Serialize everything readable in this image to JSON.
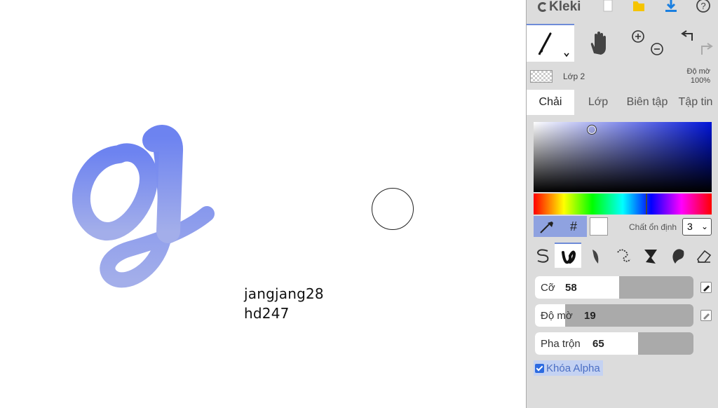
{
  "canvas": {
    "text_line_1": "jangjang28",
    "text_line_2": "hd247",
    "stroke_gradient": [
      "#6d83f0",
      "#9ea8ea"
    ]
  },
  "toolbar": {
    "logo": "Kleki",
    "icons": [
      "new-file-icon",
      "save-icon",
      "download-icon",
      "help-icon"
    ]
  },
  "tools": {
    "brush": "brush-icon",
    "hand": "hand-icon",
    "zoom_in": "zoom-in-icon",
    "zoom_out": "zoom-out-icon",
    "undo": "undo-icon",
    "redo": "redo-icon"
  },
  "layer": {
    "name": "Lớp 2",
    "opacity_label": "Độ mờ",
    "opacity_value": "100%"
  },
  "tabs": [
    {
      "label": "Chải",
      "active": true
    },
    {
      "label": "Lớp",
      "active": false
    },
    {
      "label": "Biên tập",
      "active": false
    },
    {
      "label": "Tập tin",
      "active": false
    }
  ],
  "color": {
    "primary": "#0014d8",
    "secondary": "#ffffff",
    "hex_button": "#",
    "stabilizer_label": "Chất ổn định",
    "stabilizer_value": "3"
  },
  "brushes": [
    "pen-brush-icon",
    "blend-brush-icon",
    "sketchy-brush-icon",
    "pixel-brush-icon",
    "chemy-brush-icon",
    "smudge-brush-icon",
    "eraser-icon"
  ],
  "sliders": {
    "size": {
      "label": "Cỡ",
      "value": "58",
      "fraction": 0.53
    },
    "opacity": {
      "label": "Độ mờ",
      "value": "19",
      "fraction": 0.19
    },
    "blend": {
      "label": "Pha trộn",
      "value": "65",
      "fraction": 0.65
    }
  },
  "alpha_lock": {
    "label": "Khóa Alpha",
    "checked": true
  }
}
